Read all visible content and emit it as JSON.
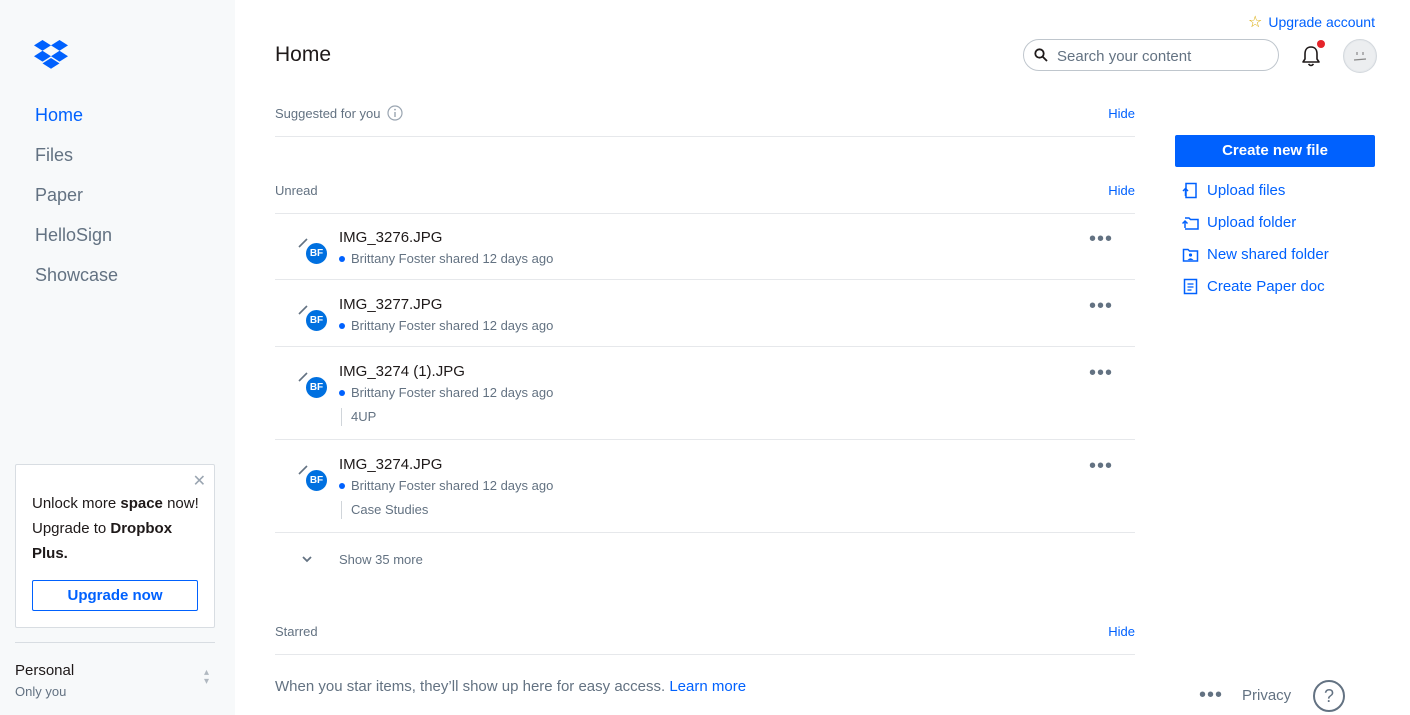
{
  "sidebar": {
    "nav": [
      {
        "label": "Home",
        "active": true
      },
      {
        "label": "Files",
        "active": false
      },
      {
        "label": "Paper",
        "active": false
      },
      {
        "label": "HelloSign",
        "active": false
      },
      {
        "label": "Showcase",
        "active": false
      }
    ],
    "promo": {
      "line1_pre": "Unlock more ",
      "line1_bold": "space",
      "line1_post": " now!",
      "line2_pre": "Upgrade to ",
      "line2_bold": "Dropbox Plus.",
      "button": "Upgrade now"
    },
    "account": {
      "name": "Personal",
      "sub": "Only you"
    }
  },
  "header": {
    "title": "Home",
    "upgrade_link": "Upgrade account",
    "search_placeholder": "Search your content"
  },
  "suggested": {
    "title": "Suggested for you",
    "hide": "Hide"
  },
  "unread": {
    "title": "Unread",
    "hide": "Hide",
    "items": [
      {
        "name": "IMG_3276.JPG",
        "meta": "Brittany Foster shared 12 days ago",
        "initials": "BF",
        "folder": ""
      },
      {
        "name": "IMG_3277.JPG",
        "meta": "Brittany Foster shared 12 days ago",
        "initials": "BF",
        "folder": ""
      },
      {
        "name": "IMG_3274 (1).JPG",
        "meta": "Brittany Foster shared 12 days ago",
        "initials": "BF",
        "folder": "4UP"
      },
      {
        "name": "IMG_3274.JPG",
        "meta": "Brittany Foster shared 12 days ago",
        "initials": "BF",
        "folder": "Case Studies"
      }
    ],
    "show_more": "Show 35 more"
  },
  "starred": {
    "title": "Starred",
    "hide": "Hide",
    "empty_text": "When you star items, they’ll show up here for easy access.",
    "learn_more": "Learn more"
  },
  "actions": {
    "create": "Create new file",
    "items": [
      {
        "label": "Upload files",
        "icon": "upload-files-icon"
      },
      {
        "label": "Upload folder",
        "icon": "upload-folder-icon"
      },
      {
        "label": "New shared folder",
        "icon": "shared-folder-icon"
      },
      {
        "label": "Create Paper doc",
        "icon": "paper-doc-icon"
      }
    ]
  },
  "footer": {
    "privacy": "Privacy",
    "help": "?"
  },
  "colors": {
    "accent": "#0061fe",
    "notification": "#e5242a",
    "badge": "#0070e0"
  }
}
